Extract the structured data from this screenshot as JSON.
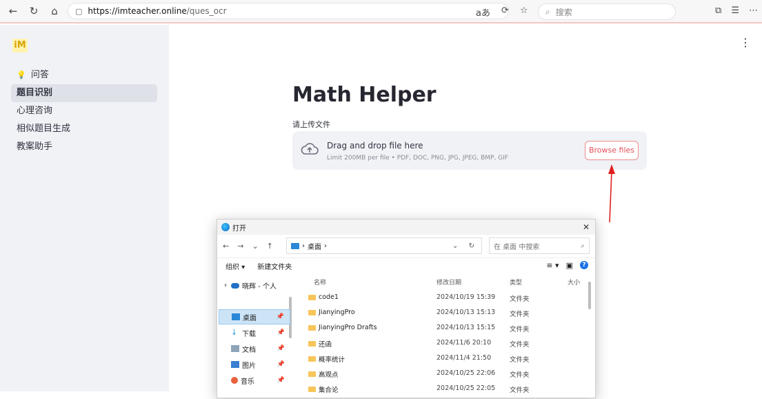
{
  "browser": {
    "url_domain": "https://imteacher.online",
    "url_path": "/ques_ocr",
    "search_placeholder": "搜索",
    "translate_label": "aあ"
  },
  "sidebar": {
    "logo": "iM",
    "items": [
      {
        "label": "问答"
      },
      {
        "label": "题目识别"
      },
      {
        "label": "心理咨询"
      },
      {
        "label": "相似题目生成"
      },
      {
        "label": "教案助手"
      }
    ]
  },
  "main": {
    "title": "Math Helper",
    "upload_label": "请上传文件",
    "drop_title": "Drag and drop file here",
    "drop_limit": "Limit 200MB per file • PDF, DOC, PNG, JPG, JPEG, BMP, GIF",
    "browse_label": "Browse files"
  },
  "dialog": {
    "title": "打开",
    "path": "桌面",
    "search_placeholder": "在 桌面 中搜索",
    "toolbar": {
      "organize": "组织 ▾",
      "new_folder": "新建文件夹"
    },
    "tree_top": "晓辉 - 个人",
    "quick_access": [
      {
        "label": "桌面",
        "color": "#2b88d8"
      },
      {
        "label": "下载",
        "color": "#2e9ad8"
      },
      {
        "label": "文档",
        "color": "#8ea4b8"
      },
      {
        "label": "图片",
        "color": "#3a7fd0"
      },
      {
        "label": "音乐",
        "color": "#e8603c"
      }
    ],
    "columns": {
      "name": "名称",
      "date": "修改日期",
      "type": "类型",
      "size": "大小"
    },
    "files": [
      {
        "name": "code1",
        "date": "2024/10/19 15:39",
        "type": "文件夹"
      },
      {
        "name": "JianyingPro",
        "date": "2024/10/13 15:13",
        "type": "文件夹"
      },
      {
        "name": "JianyingPro Drafts",
        "date": "2024/10/13 15:15",
        "type": "文件夹"
      },
      {
        "name": "还函",
        "date": "2024/11/6 20:10",
        "type": "文件夹"
      },
      {
        "name": "概率统计",
        "date": "2024/11/4 21:50",
        "type": "文件夹"
      },
      {
        "name": "高观点",
        "date": "2024/10/25 22:06",
        "type": "文件夹"
      },
      {
        "name": "集合论",
        "date": "2024/10/25 22:05",
        "type": "文件夹"
      }
    ]
  }
}
